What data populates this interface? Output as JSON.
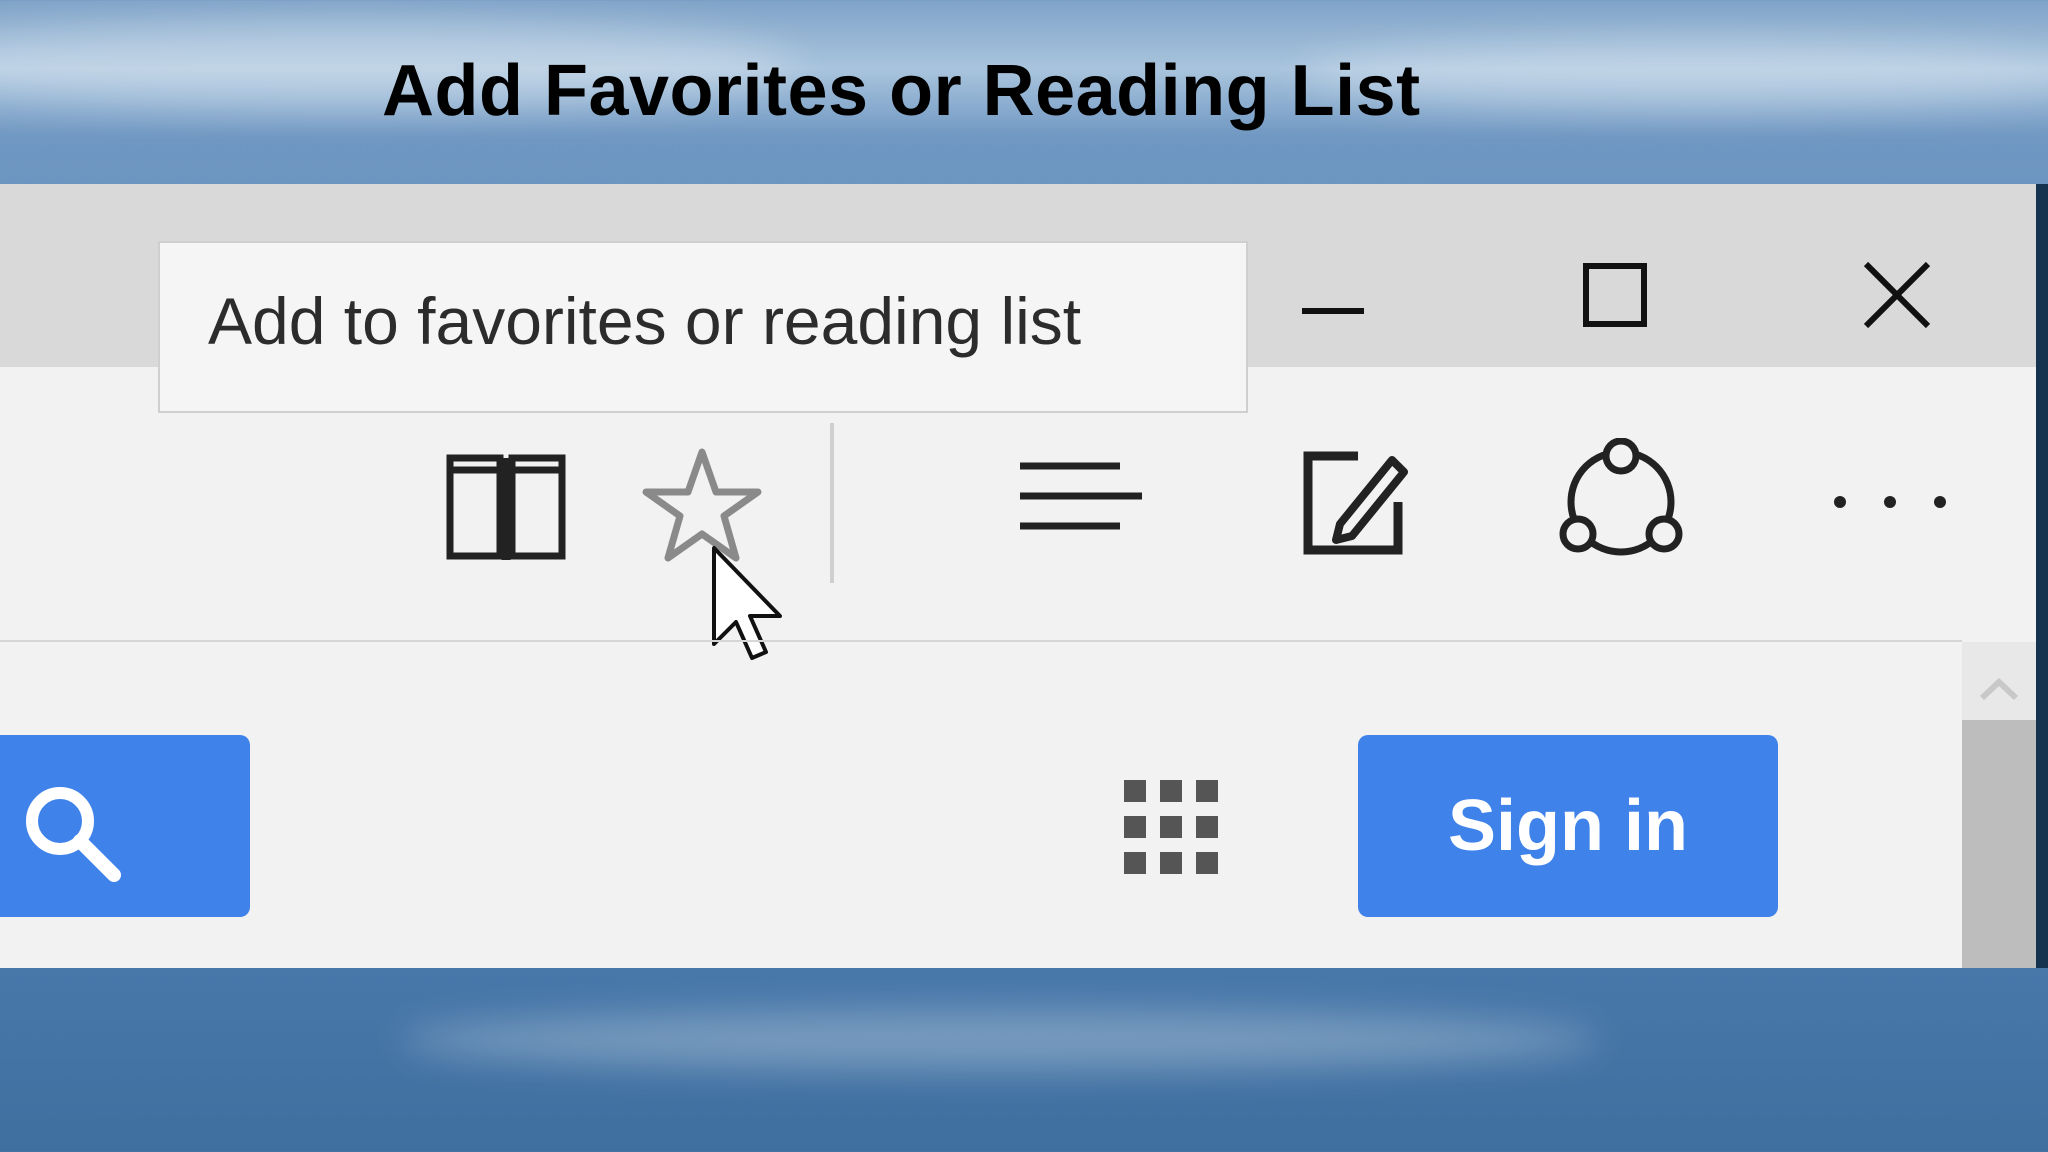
{
  "slide": {
    "title": "Add Favorites or Reading List"
  },
  "tooltip": {
    "text": "Add to favorites or reading list"
  },
  "window_controls": {
    "minimize_icon": "minimize-icon",
    "maximize_icon": "maximize-icon",
    "close_icon": "close-icon"
  },
  "toolbar": {
    "icons": [
      "reading-view-icon",
      "favorites-star-icon",
      "hub-icon",
      "web-note-icon",
      "share-icon",
      "more-icon"
    ]
  },
  "page": {
    "search_icon": "search-icon",
    "apps_icon": "apps-grid-icon",
    "signin_label": "Sign in"
  },
  "colors": {
    "accent_blue": "#3f82ea",
    "chrome_gray": "#d9d9d9",
    "page_bg": "#f3f2f2"
  }
}
